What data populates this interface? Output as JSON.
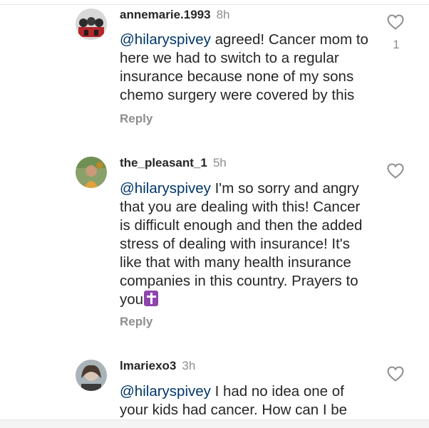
{
  "comments": [
    {
      "username": "annemarie.1993",
      "time": "8h",
      "mention": "@hilaryspivey",
      "text": " agreed! Cancer mom to here we had to switch to a regular insurance because none of my sons chemo surgery were covered by this",
      "reply_label": "Reply",
      "like_count": "1",
      "icon": "heart-outline"
    },
    {
      "username": "the_pleasant_1",
      "time": "5h",
      "mention": "@hilaryspivey",
      "text": " I'm so sorry and angry that you are dealing with this! Cancer is difficult enough and then the added stress of dealing with insurance! It's like that with many health insurance companies in this country. Prayers to you",
      "emoji": "latin-cross-emoji",
      "reply_label": "Reply",
      "icon": "heart-outline"
    },
    {
      "username": "lmariexo3",
      "time": "3h",
      "mention": "@hilaryspivey",
      "text": " I had no idea one of your kids had cancer. How can I be",
      "icon": "heart-outline"
    }
  ],
  "colors": {
    "mention": "#00376b",
    "secondary_text": "#8e8e8e",
    "primary_text": "#262626"
  }
}
